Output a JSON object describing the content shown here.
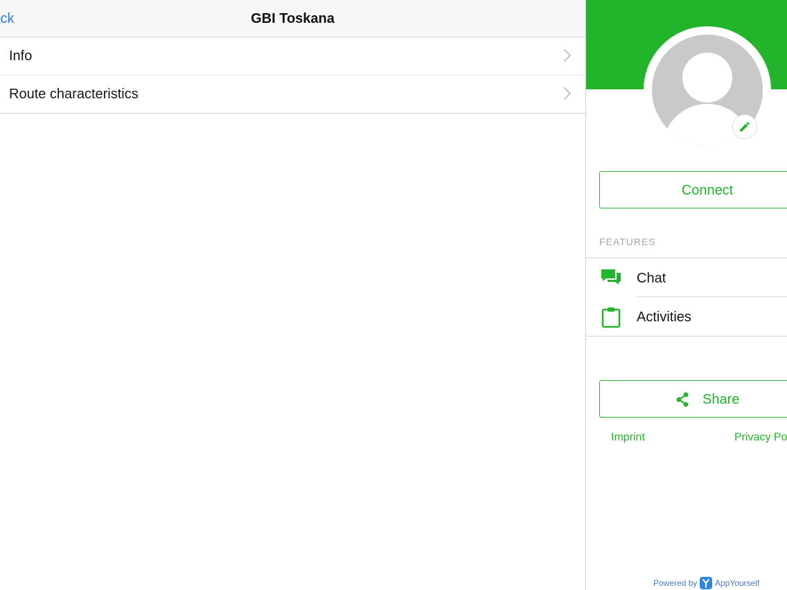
{
  "navbar": {
    "back_label": "Back",
    "title": "GBI Toskana"
  },
  "menu": {
    "items": [
      {
        "label": "Info",
        "icon": "chevron-right-icon"
      },
      {
        "label": "Route characteristics",
        "icon": "chevron-right-icon"
      }
    ]
  },
  "profile": {
    "avatar_icon": "person-silhouette-icon",
    "edit_icon": "pencil-icon",
    "connect_label": "Connect"
  },
  "features": {
    "header": "FEATURES",
    "items": [
      {
        "label": "Chat",
        "icon": "chat-bubbles-icon"
      },
      {
        "label": "Activities",
        "icon": "clipboard-icon"
      }
    ]
  },
  "share": {
    "label": "Share",
    "icon": "share-icon"
  },
  "footer": {
    "imprint": "Imprint",
    "privacy": "Privacy Policy",
    "powered_by": "Powered by",
    "brand": "AppYourself"
  },
  "colors": {
    "accent": "#22b52b",
    "link_blue": "#2f7bd8",
    "avatar_grey": "#c9c9c9"
  }
}
